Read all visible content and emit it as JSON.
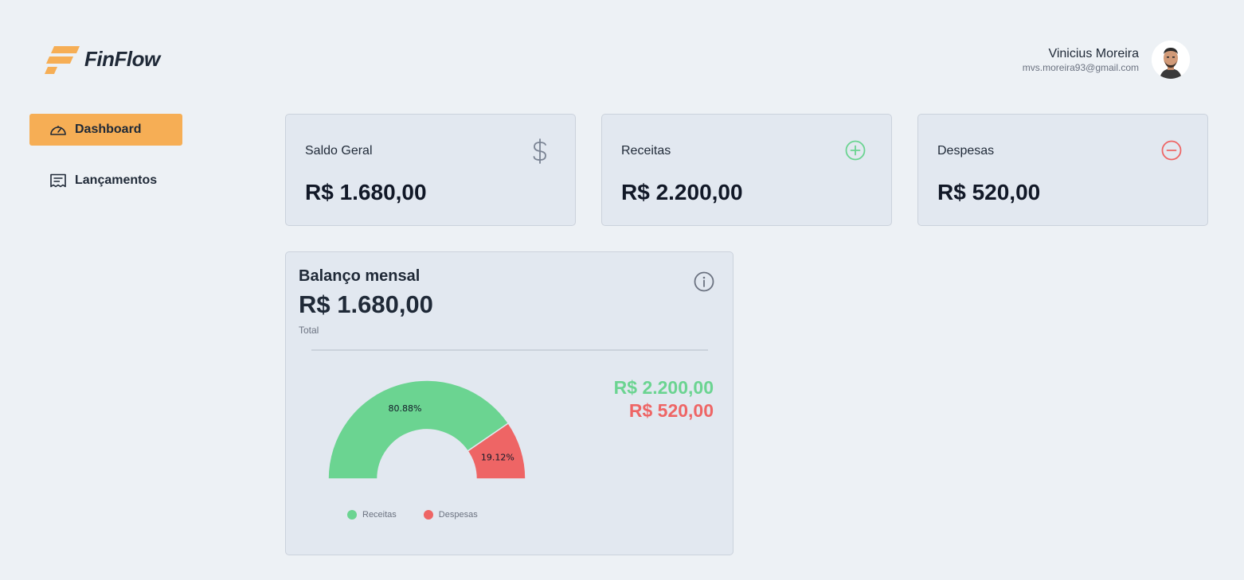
{
  "brand": {
    "name": "FinFlow",
    "accent": "#f6ae55"
  },
  "user": {
    "name": "Vinicius Moreira",
    "email": "mvs.moreira93@gmail.com"
  },
  "nav": {
    "items": [
      {
        "label": "Dashboard",
        "icon": "gauge-icon",
        "active": true
      },
      {
        "label": "Lançamentos",
        "icon": "receipt-icon",
        "active": false
      }
    ]
  },
  "stats": [
    {
      "title": "Saldo Geral",
      "value": "R$ 1.680,00",
      "icon": "dollar-icon"
    },
    {
      "title": "Receitas",
      "value": "R$ 2.200,00",
      "icon": "plus-circle-icon",
      "color": "#6bd491"
    },
    {
      "title": "Despesas",
      "value": "R$ 520,00",
      "icon": "minus-circle-icon",
      "color": "#ee6565"
    }
  ],
  "balance": {
    "title": "Balanço mensal",
    "total": "R$ 1.680,00",
    "total_label": "Total",
    "income": "R$ 2.200,00",
    "expense": "R$ 520,00"
  },
  "chart_data": {
    "type": "pie",
    "variant": "semicircle-donut",
    "categories": [
      "Receitas",
      "Despesas"
    ],
    "values": [
      2200,
      520
    ],
    "percent_labels": [
      "80.88%",
      "19.12%"
    ],
    "colors": [
      "#6bd491",
      "#ee6565"
    ],
    "legend": "bottom"
  }
}
